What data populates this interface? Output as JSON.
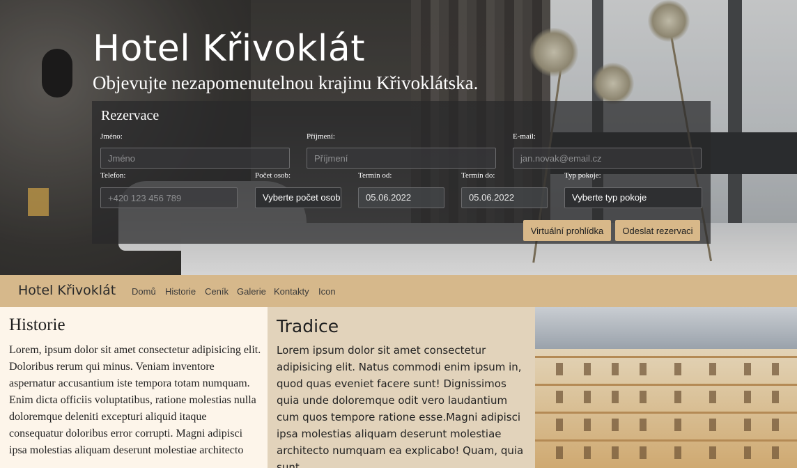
{
  "hero": {
    "title": "Hotel Křivoklát",
    "subtitle": "Objevujte nezapomenutelnou krajinu Křivoklátska."
  },
  "form": {
    "title": "Rezervace",
    "first_name": {
      "label": "Jméno:",
      "placeholder": "Jméno"
    },
    "last_name": {
      "label": "Příjmení:",
      "placeholder": "Příjmení"
    },
    "email": {
      "label": "E-mail:",
      "placeholder": "jan.novak@email.cz"
    },
    "phone": {
      "label": "Telefon:",
      "placeholder": "+420 123 456 789"
    },
    "guests": {
      "label": "Počet osob:",
      "value": "Vyberte počet osob"
    },
    "date_from": {
      "label": "Termín od:",
      "value": "05.06.2022"
    },
    "date_to": {
      "label": "Termín do:",
      "value": "05.06.2022"
    },
    "room_type": {
      "label": "Typ pokoje:",
      "value": "Vyberte typ pokoje"
    },
    "virtual_tour_label": "Virtuální prohlídka",
    "submit_label": "Odeslat rezervaci",
    "button_color": "#d8b889"
  },
  "nav": {
    "brand": "Hotel Křivoklát",
    "items": [
      "Domů",
      "Historie",
      "Ceník",
      "Galerie",
      "Kontakty",
      "Icon"
    ],
    "color": "#d6b88b"
  },
  "historie": {
    "heading": "Historie",
    "text": "Lorem, ipsum dolor sit amet consectetur adipisicing elit. Doloribus rerum qui minus. Veniam inventore aspernatur accusantium iste tempora totam numquam. Enim dicta officiis voluptatibus, ratione molestias nulla doloremque deleniti excepturi aliquid itaque consequatur doloribus error corrupti. Magni adipisci ipsa molestias aliquam deserunt molestiae architecto"
  },
  "tradice": {
    "heading": "Tradice",
    "text": "Lorem ipsum dolor sit amet consectetur adipisicing elit. Natus commodi enim ipsum in, quod quas eveniet facere sunt! Dignissimos quia unde doloremque odit vero laudantium cum quos tempore ratione esse.Magni adipisci ipsa molestias aliquam deserunt molestiae architecto numquam ea explicabo! Quam, quia sunt"
  }
}
